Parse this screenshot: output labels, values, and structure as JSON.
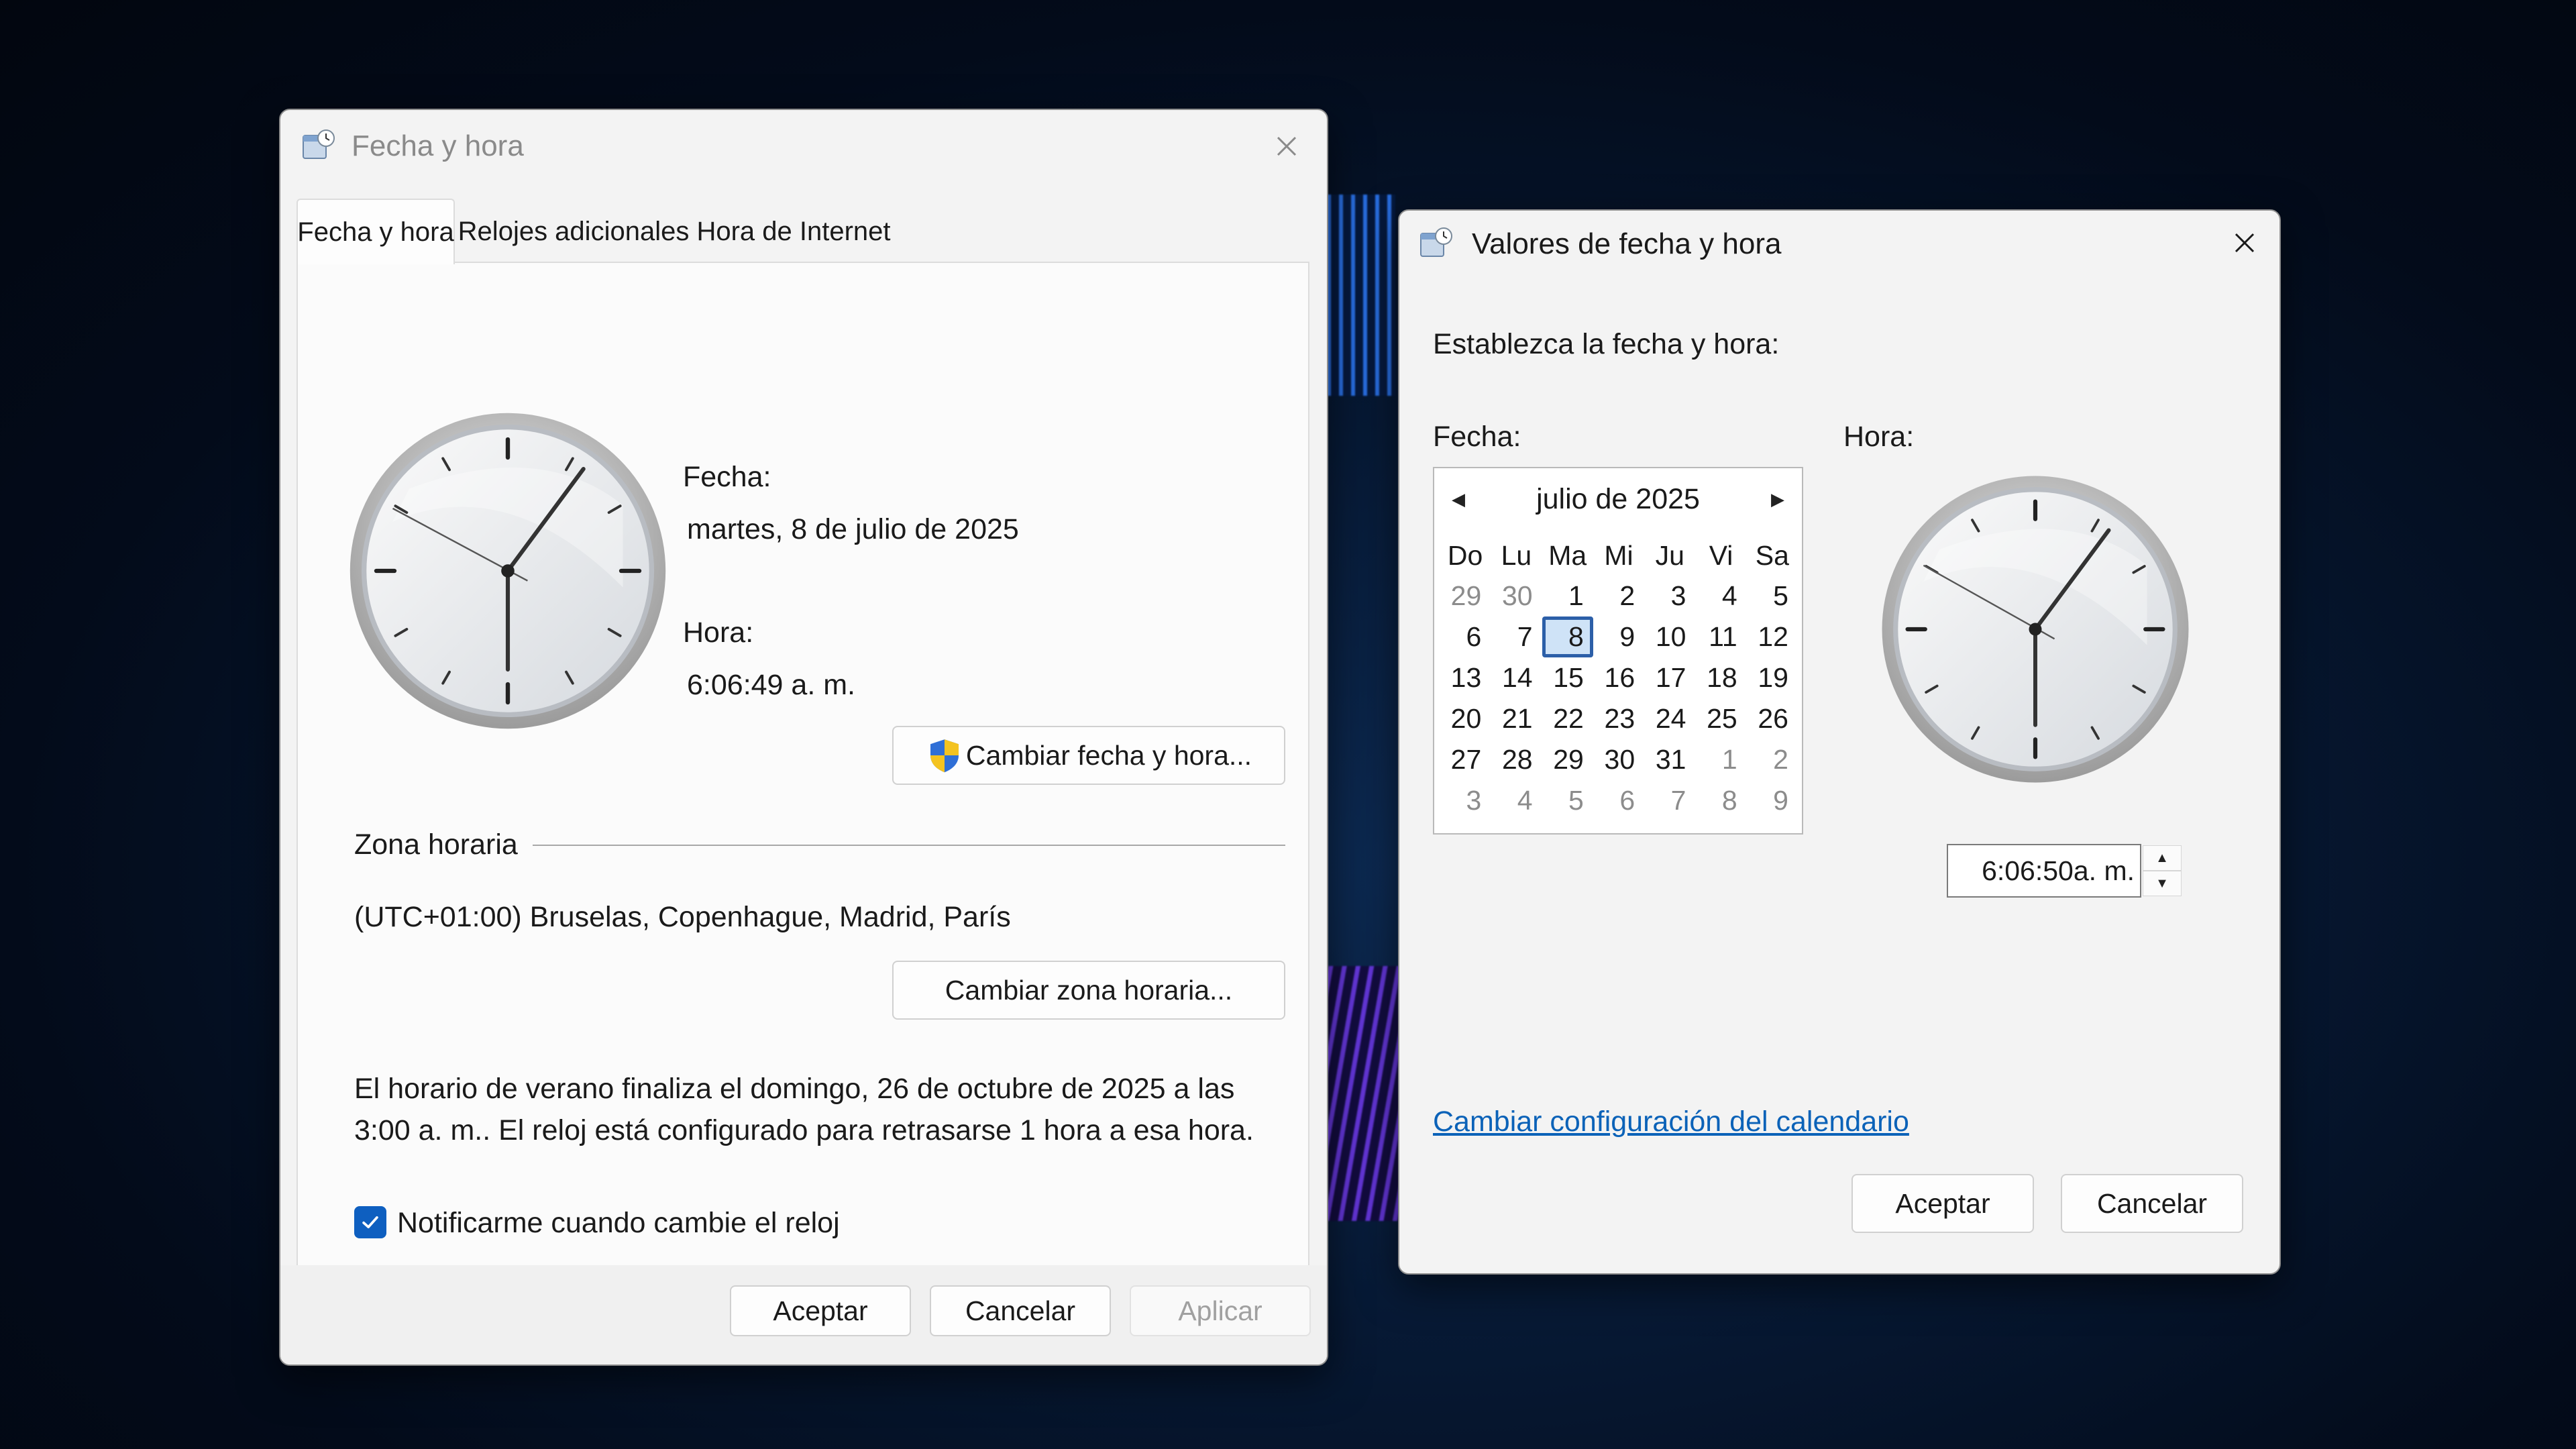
{
  "colors": {
    "accent": "#0e5fc0",
    "link": "#0b62b8",
    "window_bg": "#f3f3f3"
  },
  "left_window": {
    "title": "Fecha y hora",
    "title_icon": "date-time-icon",
    "tabs": [
      {
        "label": "Fecha y hora",
        "active": true
      },
      {
        "label": "Relojes adicionales",
        "active": false
      },
      {
        "label": "Hora de Internet",
        "active": false
      }
    ],
    "date_label": "Fecha:",
    "date_value": "martes, 8 de julio de 2025",
    "time_label": "Hora:",
    "time_value": "6:06:49 a. m.",
    "change_datetime_button": "Cambiar fecha y hora...",
    "timezone_heading": "Zona horaria",
    "timezone_value": "(UTC+01:00) Bruselas, Copenhague, Madrid, París",
    "change_timezone_button": "Cambiar zona horaria...",
    "dst_line1": "El horario de verano finaliza el domingo, 26 de octubre de 2025 a las",
    "dst_line2": "3:00 a. m.. El reloj está configurado para retrasarse 1 hora a esa hora.",
    "notify_checkbox_label": "Notificarme cuando cambie el reloj",
    "notify_checked": true,
    "footer": {
      "ok": "Aceptar",
      "cancel": "Cancelar",
      "apply": "Aplicar"
    }
  },
  "right_window": {
    "title": "Valores de fecha y hora",
    "instruction": "Establezca la fecha y hora:",
    "date_label": "Fecha:",
    "time_label": "Hora:",
    "calendar": {
      "month": "julio de 2025",
      "weekdays": [
        "Do",
        "Lu",
        "Ma",
        "Mi",
        "Ju",
        "Vi",
        "Sa"
      ],
      "weeks": [
        [
          "29",
          "30",
          "1",
          "2",
          "3",
          "4",
          "5"
        ],
        [
          "6",
          "7",
          "8",
          "9",
          "10",
          "11",
          "12"
        ],
        [
          "13",
          "14",
          "15",
          "16",
          "17",
          "18",
          "19"
        ],
        [
          "20",
          "21",
          "22",
          "23",
          "24",
          "25",
          "26"
        ],
        [
          "27",
          "28",
          "29",
          "30",
          "31",
          "1",
          "2"
        ],
        [
          "3",
          "4",
          "5",
          "6",
          "7",
          "8",
          "9"
        ]
      ],
      "selected_day": "8"
    },
    "time_input": "6:06:50a. m.",
    "calendar_settings_link": "Cambiar configuración del calendario",
    "footer": {
      "ok": "Aceptar",
      "cancel": "Cancelar"
    }
  }
}
